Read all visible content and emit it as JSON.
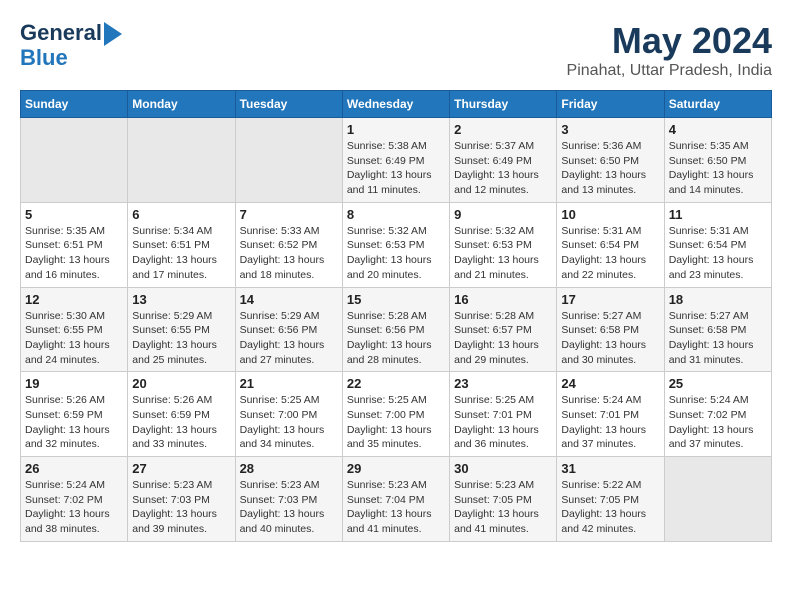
{
  "header": {
    "logo_line1": "General",
    "logo_line2": "Blue",
    "title": "May 2024",
    "subtitle": "Pinahat, Uttar Pradesh, India"
  },
  "weekdays": [
    "Sunday",
    "Monday",
    "Tuesday",
    "Wednesday",
    "Thursday",
    "Friday",
    "Saturday"
  ],
  "weeks": [
    [
      {
        "day": "",
        "empty": true
      },
      {
        "day": "",
        "empty": true
      },
      {
        "day": "",
        "empty": true
      },
      {
        "day": "1",
        "sunrise": "5:38 AM",
        "sunset": "6:49 PM",
        "daylight": "13 hours and 11 minutes."
      },
      {
        "day": "2",
        "sunrise": "5:37 AM",
        "sunset": "6:49 PM",
        "daylight": "13 hours and 12 minutes."
      },
      {
        "day": "3",
        "sunrise": "5:36 AM",
        "sunset": "6:50 PM",
        "daylight": "13 hours and 13 minutes."
      },
      {
        "day": "4",
        "sunrise": "5:35 AM",
        "sunset": "6:50 PM",
        "daylight": "13 hours and 14 minutes."
      }
    ],
    [
      {
        "day": "5",
        "sunrise": "5:35 AM",
        "sunset": "6:51 PM",
        "daylight": "13 hours and 16 minutes."
      },
      {
        "day": "6",
        "sunrise": "5:34 AM",
        "sunset": "6:51 PM",
        "daylight": "13 hours and 17 minutes."
      },
      {
        "day": "7",
        "sunrise": "5:33 AM",
        "sunset": "6:52 PM",
        "daylight": "13 hours and 18 minutes."
      },
      {
        "day": "8",
        "sunrise": "5:32 AM",
        "sunset": "6:53 PM",
        "daylight": "13 hours and 20 minutes."
      },
      {
        "day": "9",
        "sunrise": "5:32 AM",
        "sunset": "6:53 PM",
        "daylight": "13 hours and 21 minutes."
      },
      {
        "day": "10",
        "sunrise": "5:31 AM",
        "sunset": "6:54 PM",
        "daylight": "13 hours and 22 minutes."
      },
      {
        "day": "11",
        "sunrise": "5:31 AM",
        "sunset": "6:54 PM",
        "daylight": "13 hours and 23 minutes."
      }
    ],
    [
      {
        "day": "12",
        "sunrise": "5:30 AM",
        "sunset": "6:55 PM",
        "daylight": "13 hours and 24 minutes."
      },
      {
        "day": "13",
        "sunrise": "5:29 AM",
        "sunset": "6:55 PM",
        "daylight": "13 hours and 25 minutes."
      },
      {
        "day": "14",
        "sunrise": "5:29 AM",
        "sunset": "6:56 PM",
        "daylight": "13 hours and 27 minutes."
      },
      {
        "day": "15",
        "sunrise": "5:28 AM",
        "sunset": "6:56 PM",
        "daylight": "13 hours and 28 minutes."
      },
      {
        "day": "16",
        "sunrise": "5:28 AM",
        "sunset": "6:57 PM",
        "daylight": "13 hours and 29 minutes."
      },
      {
        "day": "17",
        "sunrise": "5:27 AM",
        "sunset": "6:58 PM",
        "daylight": "13 hours and 30 minutes."
      },
      {
        "day": "18",
        "sunrise": "5:27 AM",
        "sunset": "6:58 PM",
        "daylight": "13 hours and 31 minutes."
      }
    ],
    [
      {
        "day": "19",
        "sunrise": "5:26 AM",
        "sunset": "6:59 PM",
        "daylight": "13 hours and 32 minutes."
      },
      {
        "day": "20",
        "sunrise": "5:26 AM",
        "sunset": "6:59 PM",
        "daylight": "13 hours and 33 minutes."
      },
      {
        "day": "21",
        "sunrise": "5:25 AM",
        "sunset": "7:00 PM",
        "daylight": "13 hours and 34 minutes."
      },
      {
        "day": "22",
        "sunrise": "5:25 AM",
        "sunset": "7:00 PM",
        "daylight": "13 hours and 35 minutes."
      },
      {
        "day": "23",
        "sunrise": "5:25 AM",
        "sunset": "7:01 PM",
        "daylight": "13 hours and 36 minutes."
      },
      {
        "day": "24",
        "sunrise": "5:24 AM",
        "sunset": "7:01 PM",
        "daylight": "13 hours and 37 minutes."
      },
      {
        "day": "25",
        "sunrise": "5:24 AM",
        "sunset": "7:02 PM",
        "daylight": "13 hours and 37 minutes."
      }
    ],
    [
      {
        "day": "26",
        "sunrise": "5:24 AM",
        "sunset": "7:02 PM",
        "daylight": "13 hours and 38 minutes."
      },
      {
        "day": "27",
        "sunrise": "5:23 AM",
        "sunset": "7:03 PM",
        "daylight": "13 hours and 39 minutes."
      },
      {
        "day": "28",
        "sunrise": "5:23 AM",
        "sunset": "7:03 PM",
        "daylight": "13 hours and 40 minutes."
      },
      {
        "day": "29",
        "sunrise": "5:23 AM",
        "sunset": "7:04 PM",
        "daylight": "13 hours and 41 minutes."
      },
      {
        "day": "30",
        "sunrise": "5:23 AM",
        "sunset": "7:05 PM",
        "daylight": "13 hours and 41 minutes."
      },
      {
        "day": "31",
        "sunrise": "5:22 AM",
        "sunset": "7:05 PM",
        "daylight": "13 hours and 42 minutes."
      },
      {
        "day": "",
        "empty": true
      }
    ]
  ]
}
